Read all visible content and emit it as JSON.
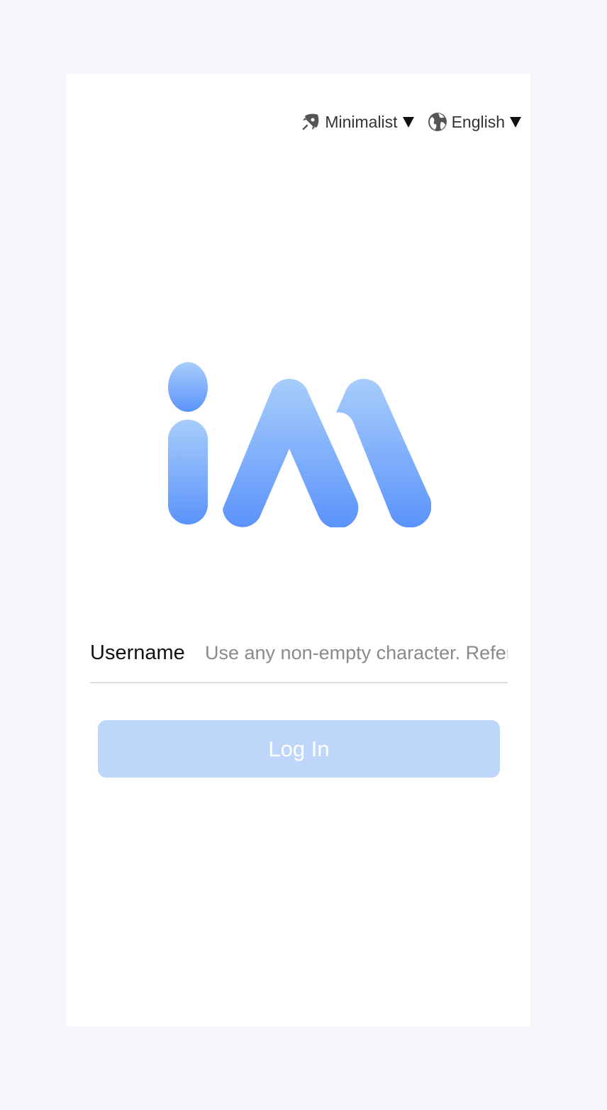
{
  "header": {
    "theme_menu": {
      "label": "Minimalist",
      "icon": "rocket-icon",
      "caret": "caret-down-icon"
    },
    "language_menu": {
      "label": "English",
      "icon": "globe-icon",
      "caret": "caret-down-icon"
    }
  },
  "logo": {
    "name": "app-logo",
    "colors": {
      "top": "#a8cdfb",
      "bottom": "#5b93fb"
    }
  },
  "login_form": {
    "username_label": "Username",
    "username_value": "",
    "username_placeholder": "Use any non-empty character. Refer",
    "login_button_label": "Log In"
  },
  "colors": {
    "page_background": "#f5f6fa",
    "card_background": "#ffffff",
    "button_disabled": "#bed6fa",
    "divider": "#dddddd"
  }
}
